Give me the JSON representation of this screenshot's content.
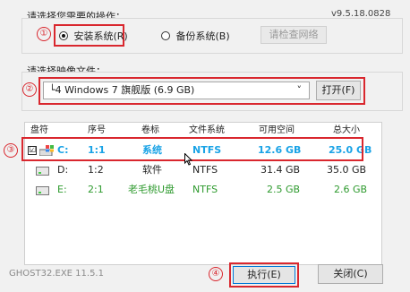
{
  "header": {
    "operation_label": "请选择您需要的操作：",
    "version": "v9.5.18.0828"
  },
  "operations": {
    "install_label": "安装系统(R)",
    "backup_label": "备份系统(B)",
    "check_network_label": "请检查网络"
  },
  "image": {
    "label": "请选择映像文件：",
    "selected": "└4 Windows 7 旗舰版 (6.9 GB)",
    "dropdown_arrow": "˅",
    "open_label": "打开(F)"
  },
  "table": {
    "headers": [
      "盘符",
      "序号",
      "卷标",
      "文件系统",
      "可用空间",
      "总大小"
    ],
    "rows": [
      {
        "drive": "C:",
        "index": "1:1",
        "label": "系统",
        "fs": "NTFS",
        "free": "12.6 GB",
        "total": "25.0 GB",
        "checked": "☑"
      },
      {
        "drive": "D:",
        "index": "1:2",
        "label": "软件",
        "fs": "NTFS",
        "free": "31.4 GB",
        "total": "35.0 GB"
      },
      {
        "drive": "E:",
        "index": "2:1",
        "label": "老毛桃U盘",
        "fs": "NTFS",
        "free": "2.5 GB",
        "total": "2.6 GB"
      }
    ]
  },
  "footer": {
    "app_version": "GHOST32.EXE 11.5.1",
    "execute_label": "执行(E)",
    "close_label": "关闭(C)"
  },
  "steps": [
    "①",
    "②",
    "③",
    "④"
  ],
  "colors": {
    "highlight": "#d9272e",
    "green": "#2e9a2e",
    "blue": "#1aa3e6"
  }
}
